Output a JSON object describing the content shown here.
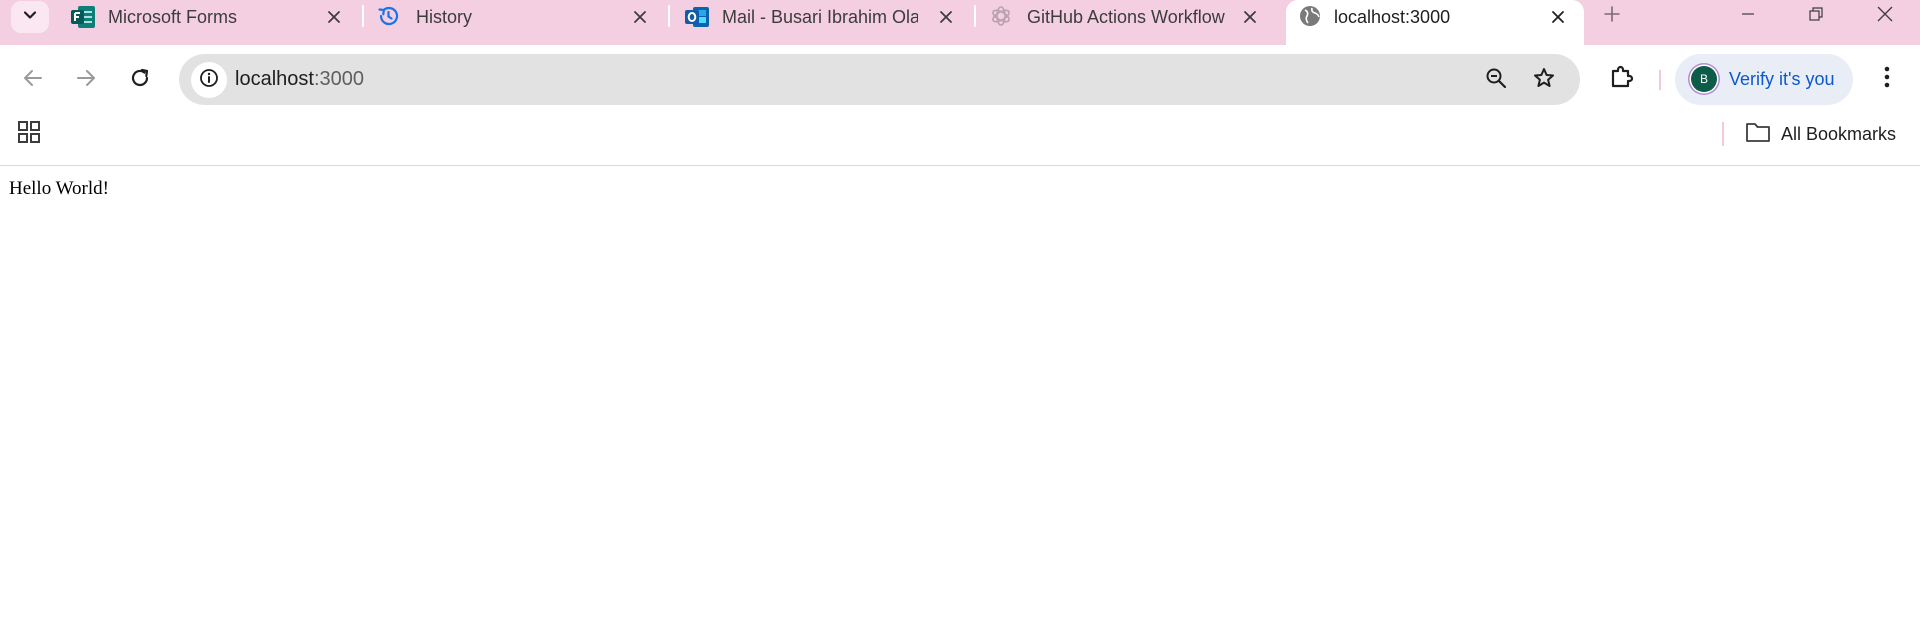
{
  "tabs": [
    {
      "title": "Microsoft Forms",
      "icon": "microsoft-forms-icon",
      "active": false
    },
    {
      "title": "History",
      "icon": "history-icon",
      "active": false
    },
    {
      "title": "Mail - Busari Ibrahim Ola",
      "icon": "outlook-icon",
      "active": false
    },
    {
      "title": "GitHub Actions Workflow",
      "icon": "chatgpt-icon",
      "active": false
    },
    {
      "title": "localhost:3000",
      "icon": "globe-icon",
      "active": true
    }
  ],
  "toolbar": {
    "url_host": "localhost",
    "url_port": ":3000"
  },
  "profile": {
    "initial": "B",
    "label": "Verify it's you"
  },
  "bookmarks": {
    "all_label": "All Bookmarks"
  },
  "page": {
    "text": "Hello World!"
  },
  "colors": {
    "tabstrip": "#f4cfe2",
    "accent": "#0b57d0",
    "avatar": "#0d5c47"
  }
}
